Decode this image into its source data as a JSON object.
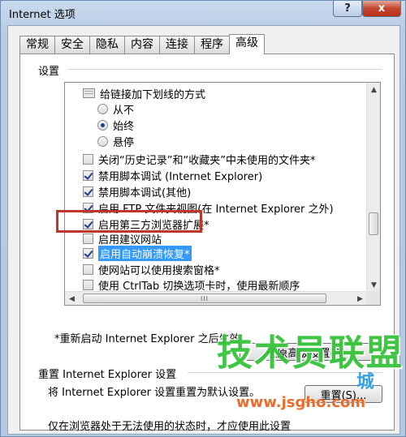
{
  "window": {
    "title": "Internet 选项",
    "help_label": "?",
    "close_label": "x"
  },
  "tabs": [
    {
      "label": "常规",
      "active": false
    },
    {
      "label": "安全",
      "active": false
    },
    {
      "label": "隐私",
      "active": false
    },
    {
      "label": "内容",
      "active": false
    },
    {
      "label": "连接",
      "active": false
    },
    {
      "label": "程序",
      "active": false
    },
    {
      "label": "高级",
      "active": true
    }
  ],
  "settings": {
    "label": "设置",
    "items": [
      {
        "kind": "folder",
        "text": "给链接加下划线的方式"
      },
      {
        "kind": "radio",
        "checked": false,
        "text": "从不"
      },
      {
        "kind": "radio",
        "checked": true,
        "text": "始终"
      },
      {
        "kind": "radio",
        "checked": false,
        "text": "悬停"
      },
      {
        "kind": "checkbox",
        "checked": false,
        "text": "关闭“历史记录”和“收藏夹”中未使用的文件夹*"
      },
      {
        "kind": "checkbox",
        "checked": true,
        "text": "禁用脚本调试 (Internet Explorer)"
      },
      {
        "kind": "checkbox",
        "checked": true,
        "text": "禁用脚本调试(其他)"
      },
      {
        "kind": "checkbox",
        "checked": true,
        "text": "启用 FTP 文件夹视图(在 Internet Explorer 之外)"
      },
      {
        "kind": "checkbox",
        "checked": true,
        "text": "启用第三方浏览器扩展*"
      },
      {
        "kind": "checkbox",
        "checked": false,
        "text": "启用建议网站"
      },
      {
        "kind": "checkbox",
        "checked": true,
        "text": "启用自动崩溃恢复*"
      },
      {
        "kind": "checkbox",
        "checked": false,
        "text": "使网站可以使用搜索窗格*"
      },
      {
        "kind": "checkbox",
        "checked": false,
        "text": "使用 CtrlTab 切换选项卡时，使用最新顺序"
      }
    ],
    "scroll_grip": "III"
  },
  "restart_note": "*重新启动 Internet Explorer 之后生效",
  "restore_button": "还原高级设置(R)",
  "reset": {
    "title": "重置 Internet Explorer 设置",
    "desc": "将 Internet Explorer 设置重置为默认设置。",
    "button": "重置(S)...",
    "bottom": "仅在浏览器处于无法使用的状态时，才应使用此设置"
  },
  "watermark": {
    "brand": "技术员联盟",
    "url": "www.jsgho.com",
    "city": "城"
  }
}
